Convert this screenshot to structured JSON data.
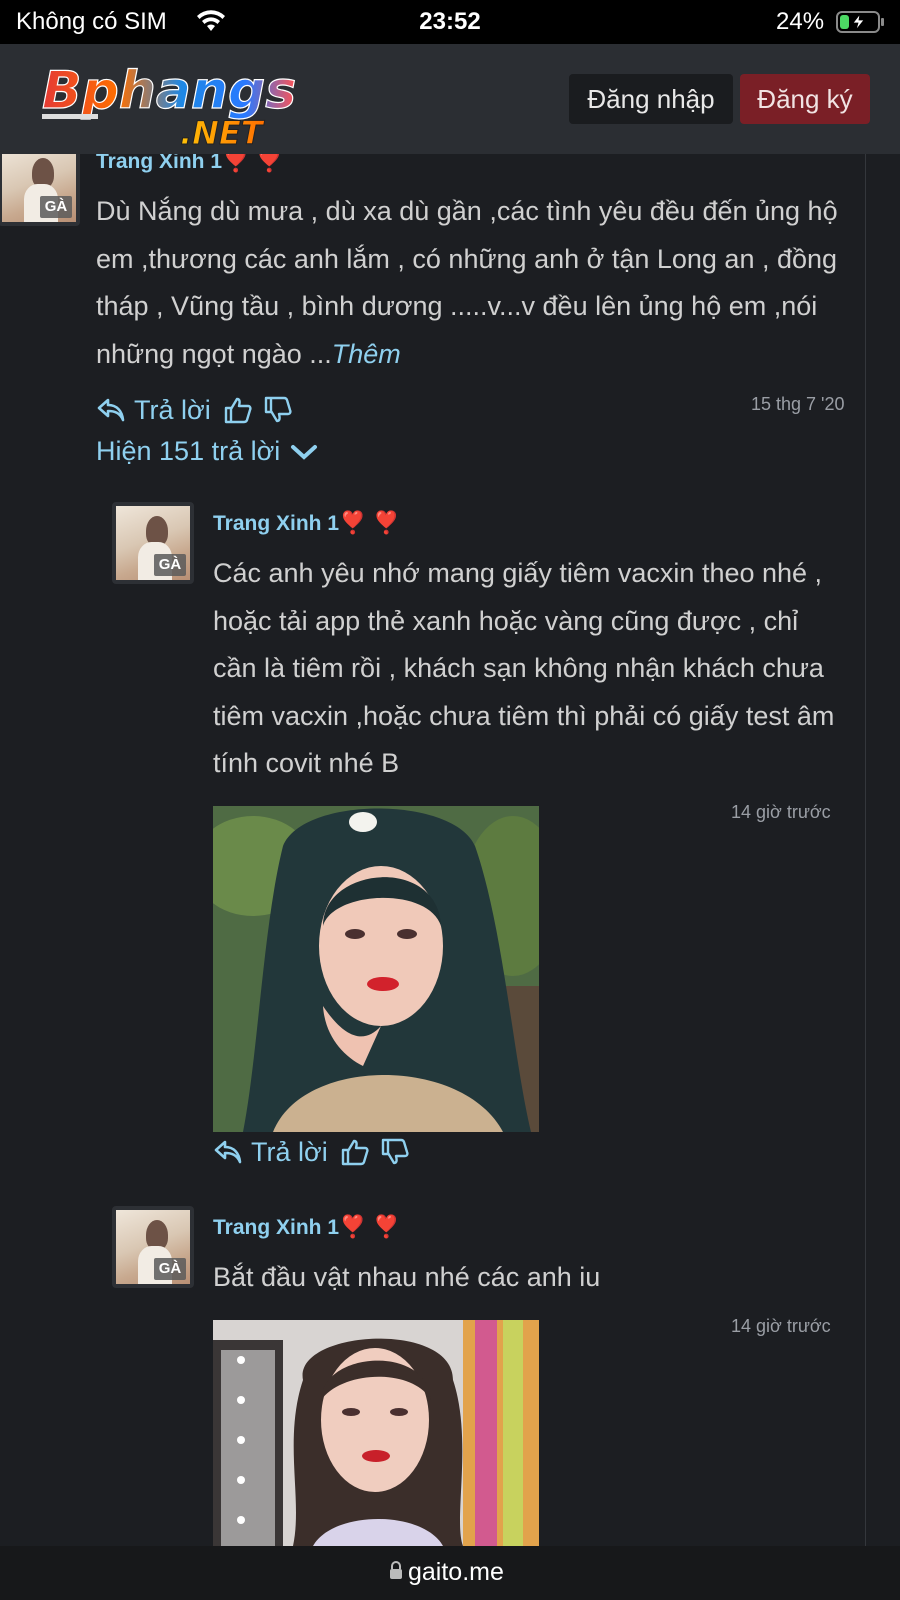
{
  "status_bar": {
    "carrier": "Không có SIM",
    "time": "23:52",
    "battery": "24%",
    "battery_level": 0.24
  },
  "header": {
    "logo_main": "Bphangs",
    "logo_sub": ".NET",
    "login_label": "Đăng nhập",
    "signup_label": "Đăng ký"
  },
  "comment": {
    "author": "Trang Xinh 1",
    "author_suffix": "❣️ ❣️",
    "avatar_badge": "GÀ",
    "text": "Dù Nắng dù mưa , dù xa dù gần ,các tình yêu đều đến ủng hộ em ,thương các anh lắm , có những anh ở tận Long an , đồng tháp , Vũng tầu , bình dương .....v...v đều lên ủng hộ em ,nói những ngọt ngào ...",
    "more_label": "Thêm",
    "reply_label": "Trả lời",
    "timestamp": "15 thg 7 '20",
    "show_replies": "Hiện 151 trả lời"
  },
  "replies": [
    {
      "author": "Trang Xinh 1",
      "author_suffix": "❣️ ❣️",
      "avatar_badge": "GÀ",
      "text": "Các anh yêu nhớ mang giấy tiêm vacxin theo nhé , hoặc tải app thẻ xanh hoặc vàng cũng được , chỉ cần là tiêm rồi , khách sạn không nhận khách chưa tiêm vacxin ,hoặc chưa tiêm thì phải có giấy test âm tính covit nhé B",
      "timestamp": "14 giờ trước",
      "reply_label": "Trả lời"
    },
    {
      "author": "Trang Xinh 1",
      "author_suffix": "❣️ ❣️",
      "avatar_badge": "GÀ",
      "text": "Bắt đầu vật nhau nhé các anh iu",
      "timestamp": "14 giờ trước"
    }
  ],
  "address_bar": {
    "url": "gaito.me"
  },
  "colors": {
    "background": "#1c1e22",
    "header": "#2b2e33",
    "accent_link": "#8fd0ef",
    "signup_button": "#7a1f26",
    "heart": "#e0303a"
  },
  "icons": [
    "wifi-icon",
    "battery-icon",
    "reply-icon",
    "thumbs-up-icon",
    "thumbs-down-icon",
    "chevron-down-icon",
    "lock-icon"
  ]
}
